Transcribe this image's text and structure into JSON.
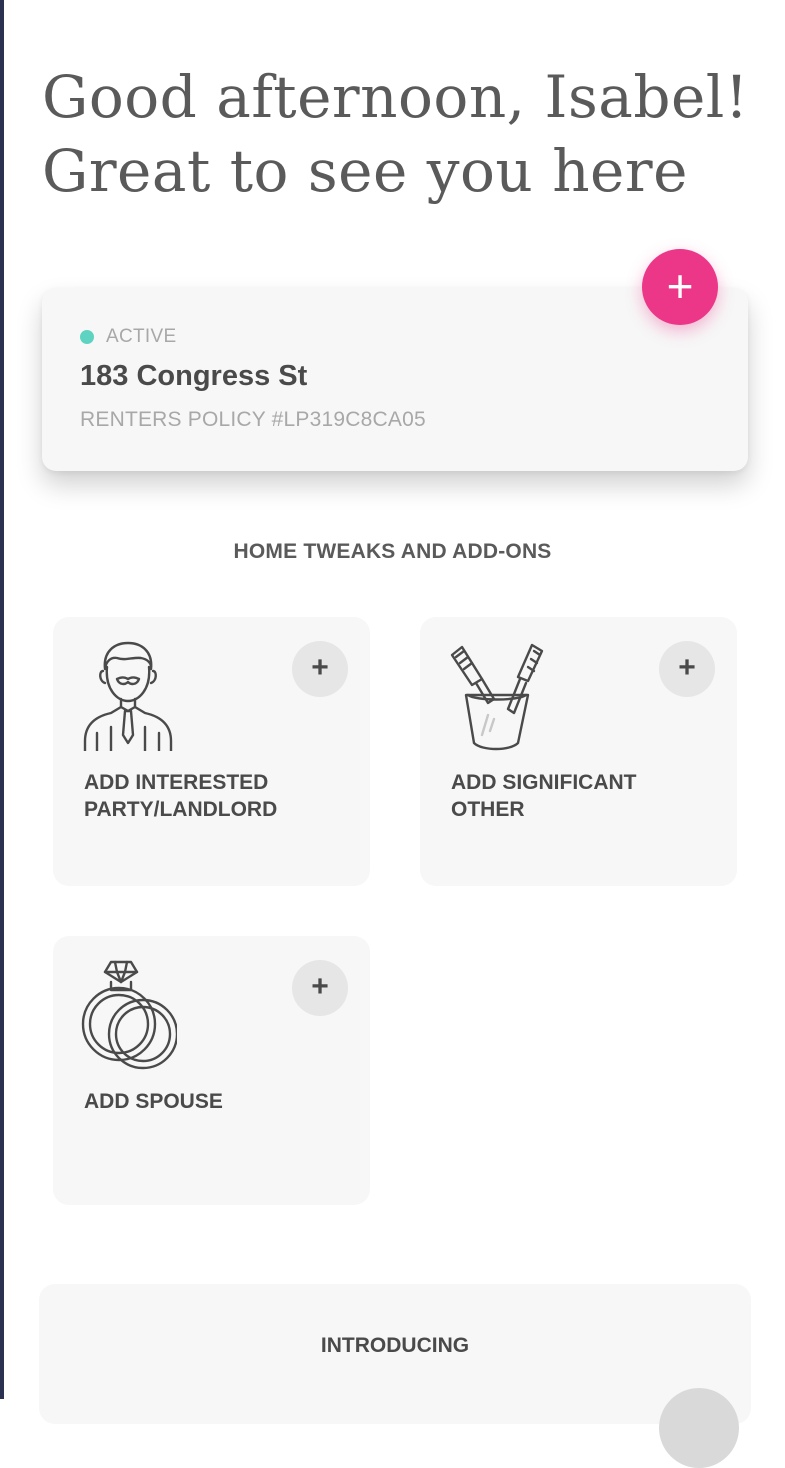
{
  "greeting": {
    "line1": "Good afternoon, Isabel!",
    "line2": "Great to see you here"
  },
  "policy": {
    "status": "ACTIVE",
    "status_color": "#5fd3c1",
    "address": "183 Congress St",
    "policy_number": "RENTERS POLICY #LP319C8CA05"
  },
  "fab": {
    "label": "+",
    "color": "#ec3688"
  },
  "addons": {
    "title": "HOME TWEAKS AND ADD-ONS",
    "items": [
      {
        "label": "ADD INTERESTED PARTY/LANDLORD",
        "icon": "landlord-icon",
        "action": "+"
      },
      {
        "label": "ADD SIGNIFICANT OTHER",
        "icon": "toothbrushes-icon",
        "action": "+"
      },
      {
        "label": "ADD SPOUSE",
        "icon": "rings-icon",
        "action": "+"
      }
    ]
  },
  "intro": {
    "label": "INTRODUCING"
  }
}
